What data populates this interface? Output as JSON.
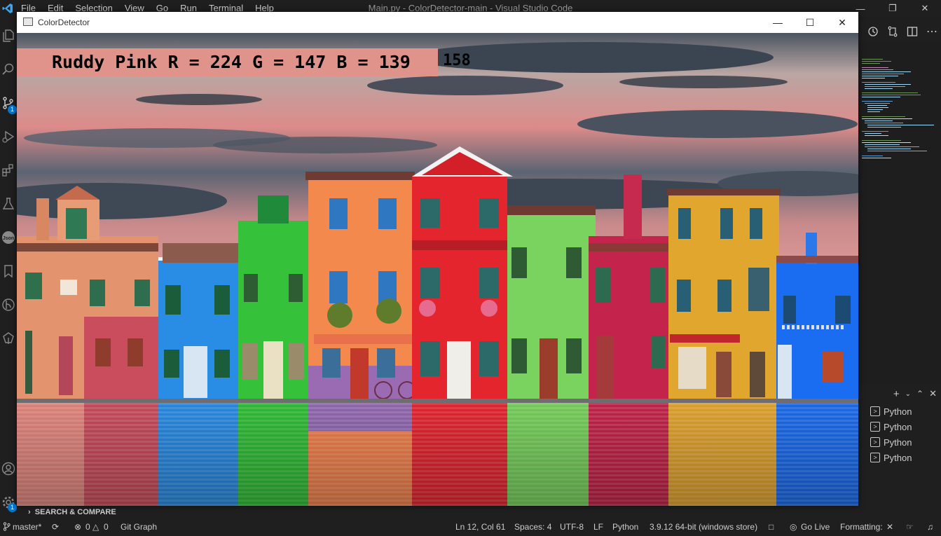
{
  "vscode": {
    "menu": [
      "File",
      "Edit",
      "Selection",
      "View",
      "Go",
      "Run",
      "Terminal",
      "Help"
    ],
    "window_title": "Main.py - ColorDetector-main - Visual Studio Code"
  },
  "activity_badges": {
    "source_control": "1",
    "settings": "1"
  },
  "color_window": {
    "title": "ColorDetector",
    "detected_color": "Ruddy Pink R = 224 G = 147 B = 139",
    "banner_color": "#e0938b",
    "overlay_number": "158"
  },
  "panels": {
    "search_compare": "SEARCH & COMPARE",
    "terminals": [
      "Python",
      "Python",
      "Python",
      "Python"
    ]
  },
  "statusbar": {
    "branch": "master*",
    "errors": "0",
    "warnings": "0",
    "git_graph": "Git Graph",
    "position": "Ln 12, Col 61",
    "spaces": "Spaces: 4",
    "encoding": "UTF-8",
    "eol": "LF",
    "language": "Python",
    "interpreter": "3.9.12 64-bit (windows store)",
    "go_live": "Go Live",
    "formatting": "Formatting:"
  }
}
